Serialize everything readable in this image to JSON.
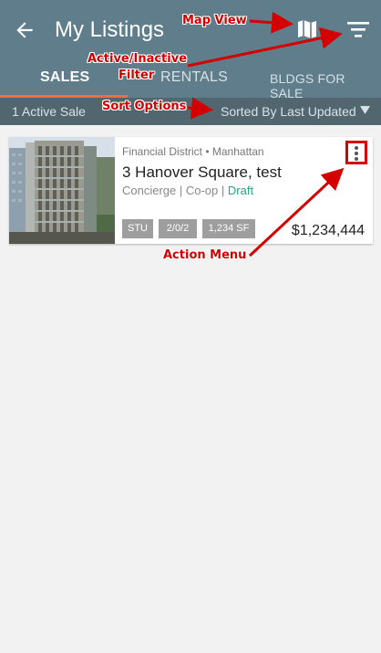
{
  "header": {
    "title": "My Listings",
    "back_icon": "arrow-left-icon",
    "map_icon": "map-icon",
    "filter_icon": "filter-icon"
  },
  "tabs": [
    {
      "label": "SALES",
      "active": true
    },
    {
      "label": "RENTALS",
      "active": false
    },
    {
      "label": "BLDGS FOR SALE",
      "active": false
    }
  ],
  "subbar": {
    "count_text": "1 Active Sale",
    "sort_text": "Sorted By Last Updated"
  },
  "listing": {
    "location": "Financial District • Manhattan",
    "address": "3 Hanover Square, test",
    "amenities": "Concierge | Co-op |",
    "status": "Draft",
    "badges": [
      "STU",
      "2/0/2",
      "1,234 SF"
    ],
    "price": "$1,234,444"
  },
  "annotations": {
    "map_view": "Map View",
    "filter_line1": "Active/Inactive",
    "filter_line2": "Filter",
    "sort_options": "Sort Options",
    "action_menu": "Action Menu"
  },
  "colors": {
    "appbar": "#5f7d8b",
    "subbar": "#51666f",
    "tab_indicator": "#f26d3d",
    "annotation": "#d40000",
    "draft": "#2aa287"
  }
}
